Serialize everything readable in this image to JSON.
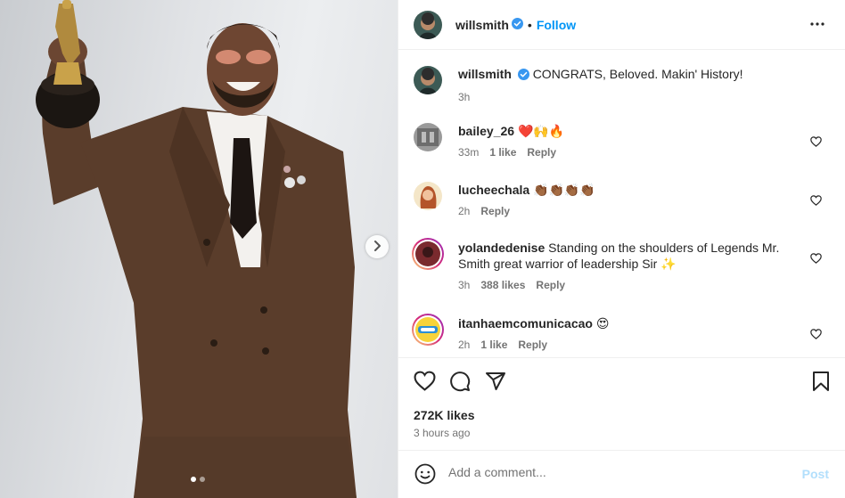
{
  "post": {
    "author": "willsmith",
    "follow_label": "Follow",
    "separator": "•",
    "caption_text": "CONGRATS, Beloved. Makin' History!",
    "caption_time": "3h"
  },
  "comments": [
    {
      "user": "bailey_26",
      "text": "❤️🙌🔥",
      "time": "33m",
      "likes": "1 like",
      "reply": "Reply"
    },
    {
      "user": "lucheechala",
      "text": "👏🏾👏🏾👏🏾👏🏾",
      "time": "2h",
      "likes": "",
      "reply": "Reply"
    },
    {
      "user": "yolandedenise",
      "text": "Standing on the shoulders of Legends Mr. Smith great warrior of leadership Sir ✨",
      "time": "3h",
      "likes": "388 likes",
      "reply": "Reply"
    },
    {
      "user": "itanhaemcomunicacao",
      "text": "😍",
      "time": "2h",
      "likes": "1 like",
      "reply": "Reply"
    }
  ],
  "stats": {
    "likes": "272K likes",
    "time_ago": "3 hours ago"
  },
  "composer": {
    "placeholder": "Add a comment...",
    "post_label": "Post"
  },
  "icons": {
    "like": "heart-icon",
    "comment": "comment-bubble-icon",
    "share": "paper-plane-icon",
    "save": "bookmark-icon",
    "more": "more-options-icon",
    "verified": "verified-badge-icon",
    "emoji": "emoji-smiley-icon",
    "next": "chevron-right-icon"
  },
  "colors": {
    "accent": "#0095f6",
    "post_disabled": "#b2dffc",
    "verified": "#3897f0",
    "suit": "#5a3d2b"
  },
  "carousel": {
    "slides": 2,
    "active": 1
  }
}
